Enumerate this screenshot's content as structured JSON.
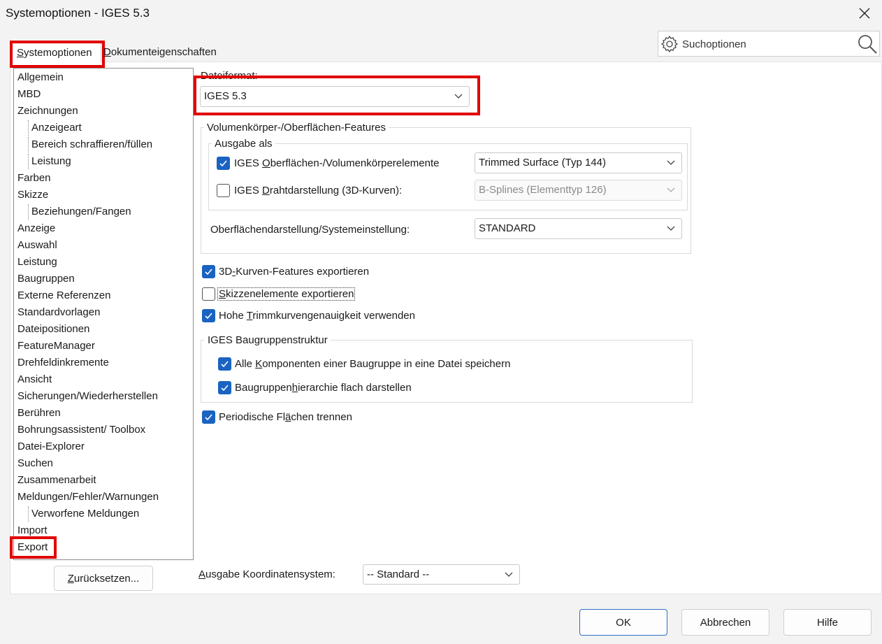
{
  "window": {
    "title": "Systemoptionen - IGES 5.3"
  },
  "tabs": {
    "system_prefix": "S",
    "system_rest": "ystemoptionen",
    "doc_prefix": "D",
    "doc_rest": "okumenteigenschaften"
  },
  "search": {
    "placeholder": "Suchoptionen"
  },
  "tree": {
    "items": [
      {
        "label": "Allgemein"
      },
      {
        "label": "MBD"
      },
      {
        "label": "Zeichnungen"
      },
      {
        "label": "Anzeigeart"
      },
      {
        "label": "Bereich schraffieren/füllen"
      },
      {
        "label": "Leistung"
      },
      {
        "label": "Farben"
      },
      {
        "label": "Skizze"
      },
      {
        "label": "Beziehungen/Fangen"
      },
      {
        "label": "Anzeige"
      },
      {
        "label": "Auswahl"
      },
      {
        "label": "Leistung"
      },
      {
        "label": "Baugruppen"
      },
      {
        "label": "Externe Referenzen"
      },
      {
        "label": "Standardvorlagen"
      },
      {
        "label": "Dateipositionen"
      },
      {
        "label": "FeatureManager"
      },
      {
        "label": "Drehfeldinkremente"
      },
      {
        "label": "Ansicht"
      },
      {
        "label": "Sicherungen/Wiederherstellen"
      },
      {
        "label": "Berühren"
      },
      {
        "label": "Bohrungsassistent/ Toolbox"
      },
      {
        "label": "Datei-Explorer"
      },
      {
        "label": "Suchen"
      },
      {
        "label": "Zusammenarbeit"
      },
      {
        "label": "Meldungen/Fehler/Warnungen"
      },
      {
        "label": "Verworfene Meldungen"
      },
      {
        "label": "Import"
      },
      {
        "label": "Export"
      }
    ]
  },
  "reset_button": {
    "prefix": "Z",
    "rest": "urücksetzen..."
  },
  "file_format": {
    "label": "Dateiformat:",
    "value": "IGES 5.3"
  },
  "features_group": {
    "title": "Volumenkörper-/Oberflächen-Features",
    "output_as_title": "Ausgabe als",
    "surface": {
      "label_a": "IGES ",
      "label_u": "O",
      "label_b": "berflächen-/Volumenkörperelemente",
      "checked": true,
      "combo": "Trimmed Surface (Typ 144)"
    },
    "wire": {
      "label_a": "IGES ",
      "label_u": "D",
      "label_b": "rahtdarstellung (3D-Kurven):",
      "checked": false,
      "combo": "B-Splines (Elementtyp 126)"
    },
    "surface_repr": {
      "label": "Oberflächendarstellung/Systemeinstellung:",
      "combo": "STANDARD"
    }
  },
  "options": {
    "curves3d": {
      "label_a": "3D",
      "label_u": "-",
      "label_b": "Kurven-Features exportieren",
      "checked": true
    },
    "sketch": {
      "label_u": "S",
      "label_b": "kizzenelemente exportieren",
      "checked": false
    },
    "trim": {
      "label_a": "Hohe ",
      "label_u": "T",
      "label_b": "rimmkurvengenauigkeit verwenden",
      "checked": true
    }
  },
  "assembly_group": {
    "title": "IGES Baugruppenstruktur",
    "all_components": {
      "label_a": "Alle ",
      "label_u": "K",
      "label_b": "omponenten einer Baugruppe in eine Datei speichern",
      "checked": true
    },
    "flat_hierarchy": {
      "label_a": "Baugruppen",
      "label_u": "h",
      "label_b": "ierarchie flach darstellen",
      "checked": true
    }
  },
  "periodic": {
    "label_a": "Periodische Fl",
    "label_u": "ä",
    "label_b": "chen trennen",
    "checked": true
  },
  "coord_system": {
    "label_u": "A",
    "label_b": "usgabe Koordinatensystem:",
    "value": "-- Standard --"
  },
  "buttons": {
    "ok": "OK",
    "cancel": "Abbrechen",
    "help": "Hilfe"
  },
  "colors": {
    "accent": "#1a63c1",
    "highlight": "#e00000",
    "background": "#f3f3f3"
  },
  "icons": {
    "close": "close-icon",
    "gear": "gear-icon",
    "search": "search-icon",
    "chevron": "chevron-down-icon",
    "check": "checkmark-icon"
  }
}
